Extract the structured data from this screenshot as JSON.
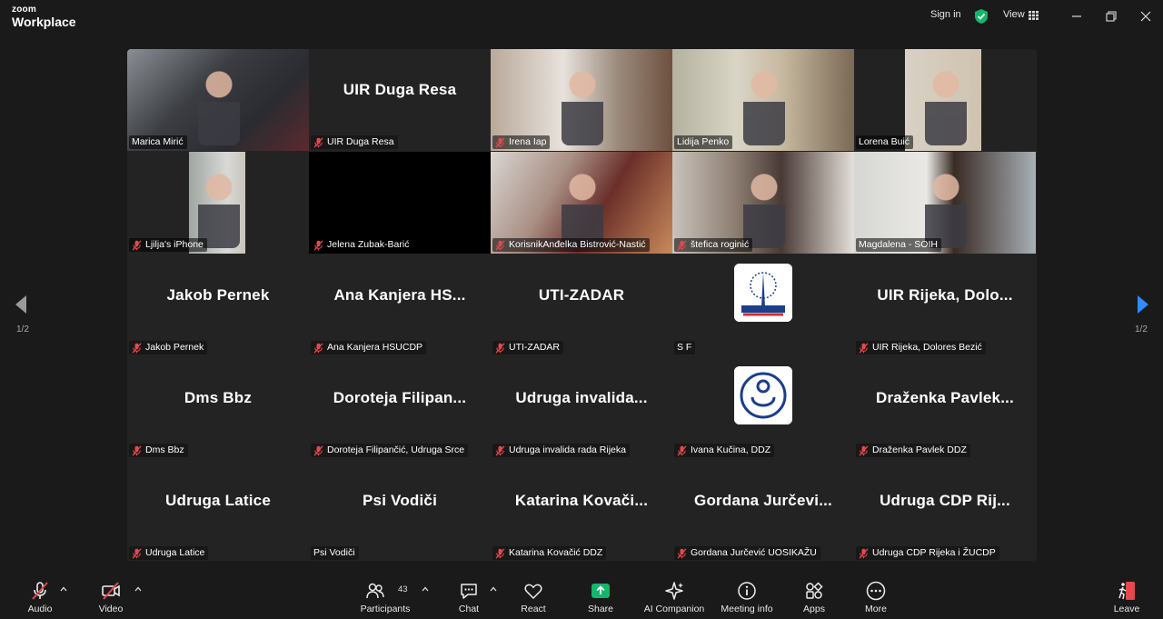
{
  "window": {
    "brand_top": "zoom",
    "brand_bottom": "Workplace",
    "sign_in": "Sign in",
    "view": "View"
  },
  "page_indicator": {
    "left": "1/2",
    "right": "1/2"
  },
  "tiles": [
    {
      "big": "",
      "label": "Marica Mirić",
      "muted": false,
      "kind": "video"
    },
    {
      "big": "UIR Duga Resa",
      "label": "UIR Duga Resa",
      "muted": true,
      "kind": "name"
    },
    {
      "big": "",
      "label": "Irena Iap",
      "muted": true,
      "kind": "video"
    },
    {
      "big": "",
      "label": "Lidija Penko",
      "muted": false,
      "kind": "video",
      "active": true
    },
    {
      "big": "",
      "label": "Lorena Buić",
      "muted": false,
      "kind": "video"
    },
    {
      "big": "",
      "label": "Ljilja's iPhone",
      "muted": true,
      "kind": "video"
    },
    {
      "big": "",
      "label": "Jelena Zubak-Barić",
      "muted": true,
      "kind": "black"
    },
    {
      "big": "",
      "label": "KorisnikAnđelka Bistrović-Nastić",
      "muted": true,
      "kind": "video"
    },
    {
      "big": "",
      "label": "štefica roginić",
      "muted": true,
      "kind": "video"
    },
    {
      "big": "",
      "label": "Magdalena - SOIH",
      "muted": false,
      "kind": "video"
    },
    {
      "big": "Jakob Pernek",
      "label": "Jakob Pernek",
      "muted": true,
      "kind": "name"
    },
    {
      "big": "Ana Kanjera HS...",
      "label": "Ana Kanjera HSUCDP",
      "muted": true,
      "kind": "name"
    },
    {
      "big": "UTI-ZADAR",
      "label": "UTI-ZADAR",
      "muted": true,
      "kind": "name"
    },
    {
      "big": "",
      "label": "S F",
      "muted": false,
      "kind": "avatar1"
    },
    {
      "big": "UIR Rijeka, Dolo...",
      "label": "UIR Rijeka, Dolores Bezić",
      "muted": true,
      "kind": "name"
    },
    {
      "big": "Dms Bbz",
      "label": "Dms Bbz",
      "muted": true,
      "kind": "name"
    },
    {
      "big": "Doroteja Filipan...",
      "label": "Doroteja Filipančić, Udruga Srce",
      "muted": true,
      "kind": "name"
    },
    {
      "big": "Udruga invalida...",
      "label": "Udruga invalida rada Rijeka",
      "muted": true,
      "kind": "name"
    },
    {
      "big": "",
      "label": "Ivana Kučina, DDZ",
      "muted": true,
      "kind": "avatar2"
    },
    {
      "big": "Draženka Pavlek...",
      "label": "Draženka Pavlek DDZ",
      "muted": true,
      "kind": "name"
    },
    {
      "big": "Udruga Latice",
      "label": "Udruga Latice",
      "muted": true,
      "kind": "name"
    },
    {
      "big": "Psi Vodiči",
      "label": "Psi Vodiči",
      "muted": false,
      "kind": "name"
    },
    {
      "big": "Katarina Kovači...",
      "label": "Katarina Kovačić DDZ",
      "muted": true,
      "kind": "name"
    },
    {
      "big": "Gordana Jurčevi...",
      "label": "Gordana Jurčević UOSIKAŽU",
      "muted": true,
      "kind": "name"
    },
    {
      "big": "Udruga CDP Rij...",
      "label": "Udruga CDP Rijeka i ŽUCDP",
      "muted": true,
      "kind": "name"
    }
  ],
  "toolbar": {
    "audio": "Audio",
    "video": "Video",
    "participants": "Participants",
    "participants_count": "43",
    "chat": "Chat",
    "react": "React",
    "share": "Share",
    "ai_companion": "AI Companion",
    "meeting_info": "Meeting info",
    "apps": "Apps",
    "more": "More",
    "leave": "Leave"
  },
  "colors": {
    "active_speaker": "#19c57b",
    "share_green": "#12b76a",
    "muted_red": "#e5484d",
    "leave_red": "#e5484d",
    "nav_blue": "#2d8cff"
  }
}
